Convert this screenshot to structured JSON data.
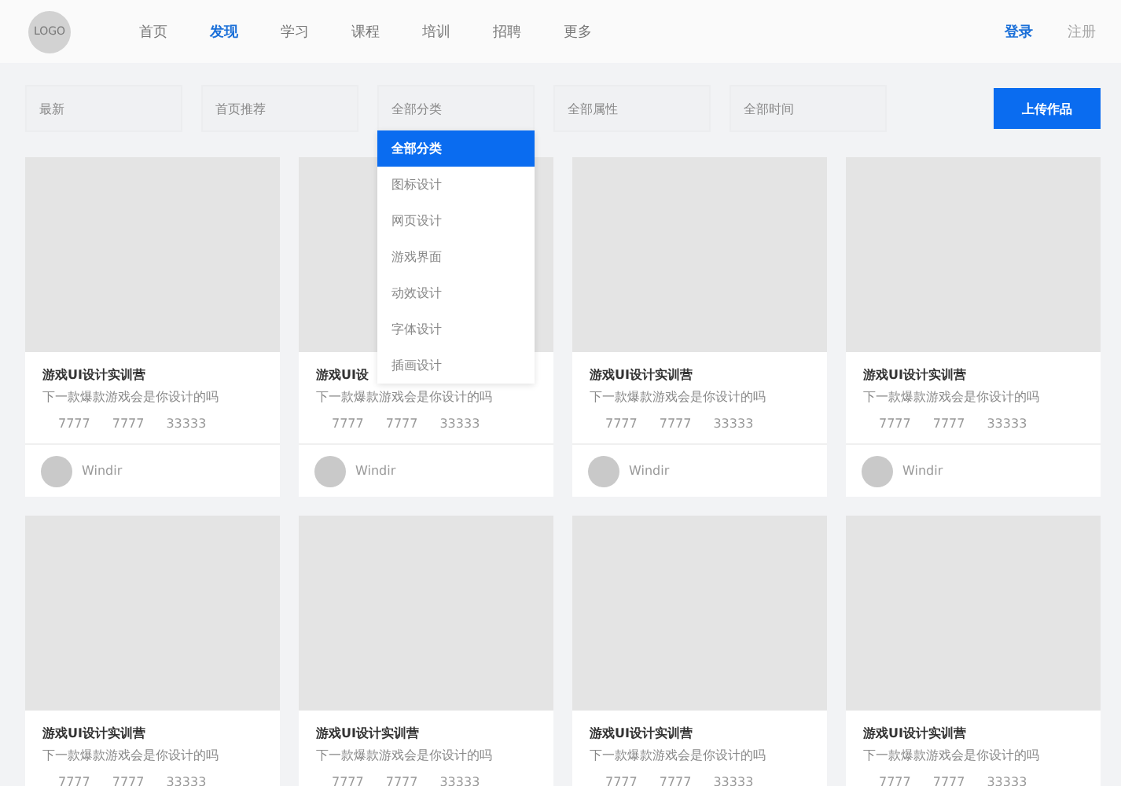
{
  "header": {
    "logo": "LOGO",
    "nav": [
      {
        "label": "首页",
        "selected": false
      },
      {
        "label": "发现",
        "selected": true
      },
      {
        "label": "学习",
        "selected": false
      },
      {
        "label": "课程",
        "selected": false
      },
      {
        "label": "培训",
        "selected": false
      },
      {
        "label": "招聘",
        "selected": false
      },
      {
        "label": "更多",
        "selected": false
      }
    ],
    "auth": [
      {
        "label": "登录",
        "disabled": false
      },
      {
        "label": "注册",
        "disabled": true
      }
    ]
  },
  "filters": [
    {
      "label": "最新"
    },
    {
      "label": "首页推荐"
    },
    {
      "label": "全部分类",
      "options": [
        {
          "label": "全部分类",
          "selected": true
        },
        {
          "label": "图标设计",
          "selected": false
        },
        {
          "label": "网页设计",
          "selected": false
        },
        {
          "label": "游戏界面",
          "selected": false
        },
        {
          "label": "动效设计",
          "selected": false
        },
        {
          "label": "字体设计",
          "selected": false
        },
        {
          "label": "插画设计",
          "selected": false
        }
      ]
    },
    {
      "label": "全部属性"
    },
    {
      "label": "全部时间"
    }
  ],
  "upload_button": "上传作品",
  "cards": [
    {
      "title": "游戏UI设计实训营",
      "description": "下一款爆款游戏会是你设计的吗",
      "stats": [
        "7777",
        "7777",
        "33333"
      ],
      "author": "Windir"
    },
    {
      "title": "游戏UI设",
      "description": "下一款爆款游戏会是你设计的吗",
      "stats": [
        "7777",
        "7777",
        "33333"
      ],
      "author": "Windir"
    },
    {
      "title": "游戏UI设计实训营",
      "description": "下一款爆款游戏会是你设计的吗",
      "stats": [
        "7777",
        "7777",
        "33333"
      ],
      "author": "Windir"
    },
    {
      "title": "游戏UI设计实训营",
      "description": "下一款爆款游戏会是你设计的吗",
      "stats": [
        "7777",
        "7777",
        "33333"
      ],
      "author": "Windir"
    },
    {
      "title": "游戏UI设计实训营",
      "description": "下一款爆款游戏会是你设计的吗",
      "stats": [
        "7777",
        "7777",
        "33333"
      ]
    },
    {
      "title": "游戏UI设计实训营",
      "description": "下一款爆款游戏会是你设计的吗",
      "stats": [
        "7777",
        "7777",
        "33333"
      ]
    },
    {
      "title": "游戏UI设计实训营",
      "description": "下一款爆款游戏会是你设计的吗",
      "stats": [
        "7777",
        "7777",
        "33333"
      ]
    },
    {
      "title": "游戏UI设计实训营",
      "description": "下一款爆款游戏会是你设计的吗",
      "stats": [
        "7777",
        "7777",
        "33333"
      ]
    }
  ]
}
